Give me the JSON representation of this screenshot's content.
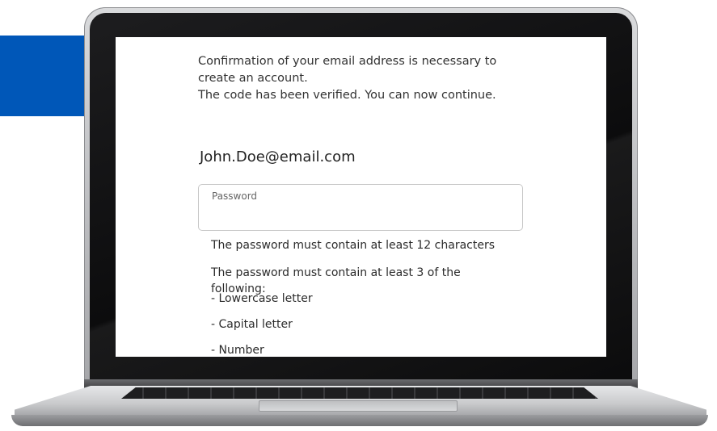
{
  "intro": {
    "line1": "Confirmation of your email address is necessary to",
    "line2": "create an account.",
    "line3": "The code has been verified. You can now continue."
  },
  "account": {
    "email": "John.Doe@email.com"
  },
  "password_field": {
    "label": "Password",
    "value": ""
  },
  "rules": {
    "min_length": "The password must contain at least 12 characters",
    "min_categories": "The password must contain at least 3 of the following:",
    "lowercase": "- Lowercase letter",
    "capital": "- Capital letter",
    "number": "- Number"
  },
  "colors": {
    "brand_blue": "#0057b8"
  }
}
